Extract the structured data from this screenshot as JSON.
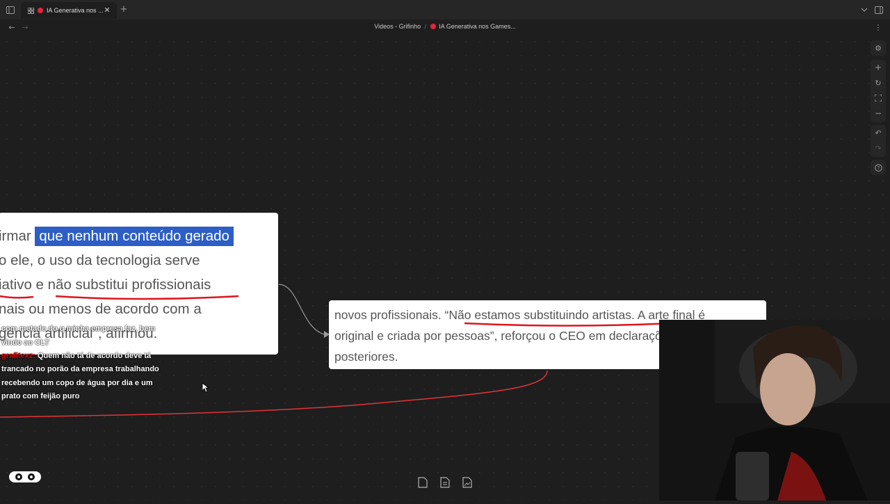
{
  "browser": {
    "tab_title": "IA Generativa nos ...",
    "breadcrumb_parent": "Videos - Grifinho",
    "breadcrumb_separator": "/",
    "breadcrumb_current": "IA Generativa nos Games..."
  },
  "canvas": {
    "card1_lines": [
      "irmar",
      "que nenhum conteúdo gerado",
      "o ele, o uso da tecnologia serve",
      "iativo e não substitui profissionais",
      "nais ou menos de acordo com a",
      "gência artificial\", afirmou."
    ],
    "card2_lines": [
      "novos profissionais. “Não estamos substituindo artistas. A arte final é",
      "original e criada por pessoas”, reforçou o CEO em declarações",
      "posteriores."
    ]
  },
  "chat": [
    {
      "username": "",
      "message": "com metade do q minha empresa faz, bem"
    },
    {
      "username": "",
      "message": "vindo ao CLT"
    },
    {
      "username": "grafitexz:",
      "message": " Quem não tá de acordo deve tá"
    },
    {
      "username": "",
      "message": "trancado no porão da empresa trabalhando"
    },
    {
      "username": "",
      "message": "recebendo um copo de água por dia e um"
    },
    {
      "username": "",
      "message": "prato com feijão puro"
    }
  ],
  "icons": {
    "sidebar_toggle": "sidebar-icon",
    "tab_grid": "grid-icon",
    "tab_close": "close-icon",
    "new_tab": "plus-icon",
    "right_tools": [
      "settings-icon",
      "zoom-in-icon",
      "refresh-icon",
      "fit-screen-icon",
      "zoom-out-icon",
      "undo-icon",
      "redo-icon",
      "help-icon"
    ],
    "bottom_tools": [
      "new-note-icon",
      "new-document-icon",
      "new-media-icon"
    ]
  },
  "colors": {
    "highlight": "#2c5ec5",
    "underline": "#e0141e",
    "connector_red": "#e3343c",
    "recording_dot": "#e5243b"
  }
}
